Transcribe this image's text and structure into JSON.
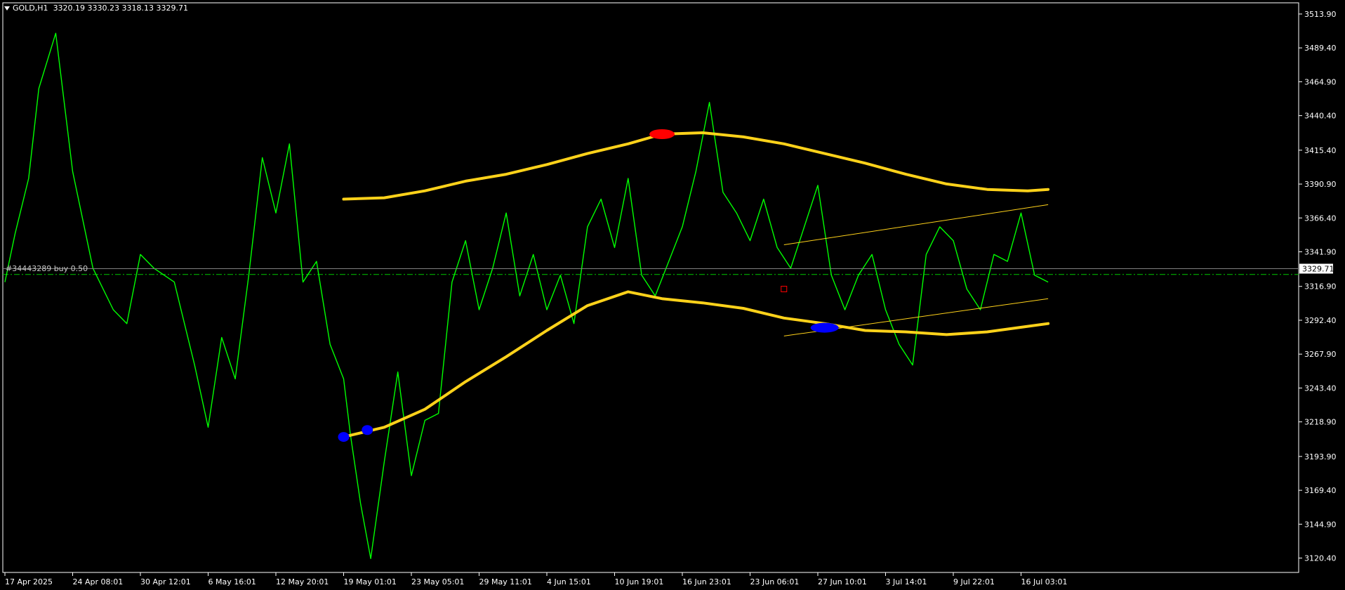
{
  "header": {
    "symbol": "GOLD,H1",
    "ohlc": "3320.19 3330.23 3318.13 3329.71"
  },
  "order_label": "#34443289 buy 0.50",
  "current_price_label": "3329.71",
  "colors": {
    "background": "#000000",
    "price_line": "#00ff00",
    "envelope": "#ffd21a",
    "channel": "#ffd21a",
    "sell_marker": "#ff0000",
    "buy_marker": "#0000ff",
    "axis": "#ffffff",
    "order_line": "#00c800"
  },
  "chart_data": {
    "type": "line",
    "instrument": "GOLD",
    "timeframe": "H1",
    "ylim": [
      3110,
      3522
    ],
    "y_ticks": [
      "3513.90",
      "3489.40",
      "3464.90",
      "3440.40",
      "3415.40",
      "3390.90",
      "3366.40",
      "3341.90",
      "3316.90",
      "3292.40",
      "3267.90",
      "3243.40",
      "3218.90",
      "3193.90",
      "3169.40",
      "3144.90",
      "3120.40"
    ],
    "x_ticks": [
      "17 Apr 2025",
      "24 Apr 08:01",
      "30 Apr 12:01",
      "6 May 16:01",
      "12 May 20:01",
      "19 May 01:01",
      "23 May 05:01",
      "29 May 11:01",
      "4 Jun 15:01",
      "10 Jun 19:01",
      "16 Jun 23:01",
      "23 Jun 06:01",
      "27 Jun 10:01",
      "3 Jul 14:01",
      "9 Jul 22:01",
      "16 Jul 03:01"
    ],
    "current_price": 3329.71,
    "order_price": 3325.5,
    "series": [
      {
        "type": "price",
        "x": [
          0,
          0.15,
          0.35,
          0.5,
          0.75,
          1,
          1.3,
          1.6,
          1.8,
          2,
          2.2,
          2.5,
          2.8,
          3,
          3.2,
          3.4,
          3.6,
          3.8,
          4,
          4.2,
          4.4,
          4.6,
          4.8,
          5,
          5.1,
          5.25,
          5.4,
          5.6,
          5.8,
          6,
          6.2,
          6.4,
          6.6,
          6.8,
          7,
          7.2,
          7.4,
          7.6,
          7.8,
          8,
          8.2,
          8.4,
          8.6,
          8.8,
          9,
          9.2,
          9.4,
          9.6,
          9.8,
          10,
          10.2,
          10.4,
          10.6,
          10.8,
          11,
          11.2,
          11.4,
          11.6,
          11.8,
          12,
          12.2,
          12.4,
          12.6,
          12.8,
          13,
          13.2,
          13.4,
          13.6,
          13.8,
          14,
          14.2,
          14.4,
          14.6,
          14.8,
          15,
          15.2,
          15.4
        ],
        "y": [
          3320,
          3355,
          3395,
          3460,
          3500,
          3400,
          3330,
          3300,
          3290,
          3340,
          3330,
          3320,
          3260,
          3215,
          3280,
          3250,
          3325,
          3410,
          3370,
          3420,
          3320,
          3335,
          3275,
          3250,
          3210,
          3160,
          3120,
          3190,
          3255,
          3180,
          3220,
          3225,
          3320,
          3350,
          3300,
          3330,
          3370,
          3310,
          3340,
          3300,
          3325,
          3290,
          3360,
          3380,
          3345,
          3395,
          3325,
          3310,
          3335,
          3360,
          3400,
          3450,
          3385,
          3370,
          3350,
          3380,
          3345,
          3330,
          3360,
          3390,
          3325,
          3300,
          3325,
          3340,
          3300,
          3275,
          3260,
          3340,
          3360,
          3350,
          3315,
          3300,
          3340,
          3335,
          3370,
          3325,
          3320
        ]
      },
      {
        "type": "envelope_upper",
        "x": [
          5,
          5.6,
          6.2,
          6.8,
          7.4,
          8,
          8.6,
          9.2,
          9.7,
          10.3,
          10.9,
          11.5,
          12.1,
          12.7,
          13.3,
          13.9,
          14.5,
          15.1,
          15.4
        ],
        "y": [
          3380,
          3381,
          3386,
          3393,
          3398,
          3405,
          3413,
          3420,
          3427,
          3428,
          3425,
          3420,
          3413,
          3406,
          3398,
          3391,
          3387,
          3386,
          3387
        ]
      },
      {
        "type": "envelope_lower",
        "x": [
          5,
          5.6,
          6.2,
          6.8,
          7.4,
          8,
          8.6,
          9.2,
          9.7,
          10.3,
          10.9,
          11.5,
          12.1,
          12.7,
          13.3,
          13.9,
          14.5,
          15.1,
          15.4
        ],
        "y": [
          3208,
          3215,
          3228,
          3248,
          3266,
          3285,
          3303,
          3313,
          3308,
          3305,
          3301,
          3294,
          3290,
          3285,
          3284,
          3282,
          3284,
          3288,
          3290
        ]
      },
      {
        "type": "channel_upper",
        "x": [
          11.5,
          15.4
        ],
        "y": [
          3347,
          3376
        ]
      },
      {
        "type": "channel_lower",
        "x": [
          11.5,
          15.4
        ],
        "y": [
          3281,
          3308
        ]
      }
    ],
    "markers": [
      {
        "type": "buy",
        "x": 5.0,
        "y": 3208
      },
      {
        "type": "buy",
        "x": 5.35,
        "y": 3213
      },
      {
        "type": "sell",
        "x": 9.7,
        "y": 3427
      },
      {
        "type": "buy",
        "x": 12.1,
        "y": 3287
      },
      {
        "type": "stop",
        "x": 11.5,
        "y": 3315
      }
    ],
    "grid": false,
    "legend": "none"
  }
}
